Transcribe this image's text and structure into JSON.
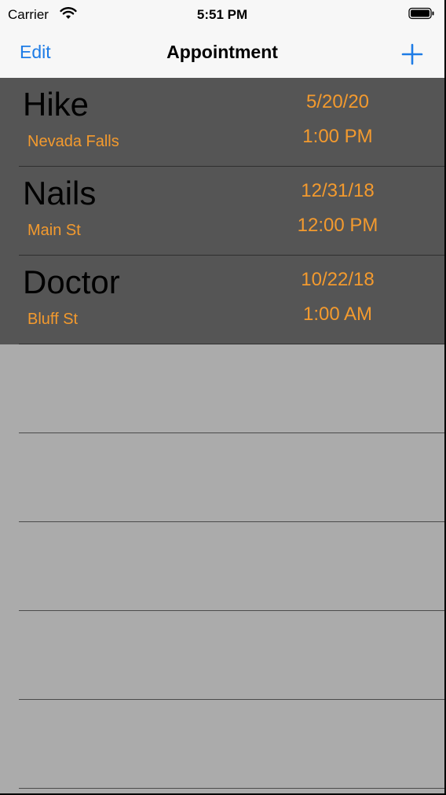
{
  "status_bar": {
    "carrier": "Carrier",
    "time": "5:51 PM"
  },
  "nav": {
    "edit_label": "Edit",
    "title": "Appointment",
    "add_icon": "plus-icon"
  },
  "colors": {
    "accent": "#1e7ce6",
    "detail": "#f39a2e",
    "cell_background": "#555555",
    "table_background": "#ababab"
  },
  "appointments": [
    {
      "title": "Hike",
      "location": "Nevada Falls",
      "date": "5/20/20",
      "time": "1:00 PM"
    },
    {
      "title": "Nails",
      "location": "Main St",
      "date": "12/31/18",
      "time": "12:00 PM"
    },
    {
      "title": "Doctor",
      "location": "Bluff St",
      "date": "10/22/18",
      "time": "1:00 AM"
    }
  ]
}
